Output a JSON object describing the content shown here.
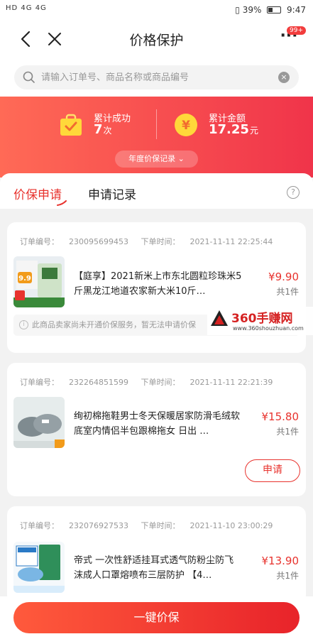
{
  "status_bar": {
    "left": "HD 4G 4G",
    "battery": "39%",
    "time": "9:47"
  },
  "nav": {
    "title": "价格保护",
    "badge": "99+"
  },
  "search": {
    "placeholder": "请输入订单号、商品名称或商品编号"
  },
  "summary": {
    "success_label": "累计成功",
    "success_value": "7",
    "success_unit": "次",
    "amount_label": "累计金额",
    "amount_value": "17.25",
    "amount_unit": "元",
    "record_link": "年度价保记录 ⌄"
  },
  "tabs": {
    "active": "价保申请",
    "inactive": "申请记录"
  },
  "orders": [
    {
      "order_label": "订单编号：",
      "order_no": "230095699453",
      "time_label": "下单时间：",
      "time": "2021-11-11 22:25:44",
      "name": "【庭享】2021新米上市东北圆粒珍珠米5斤黑龙江地道农家新大米10斤…",
      "price": "¥9.90",
      "qty": "共1件",
      "notice": "此商品卖家尚未开通价保服务，暂无法申请价保"
    },
    {
      "order_label": "订单编号：",
      "order_no": "232264851599",
      "time_label": "下单时间：",
      "time": "2021-11-11 22:21:39",
      "name": "绚初棉拖鞋男士冬天保暖居家防滑毛绒软底室内情侣半包跟棉拖女 日出 …",
      "price": "¥15.80",
      "qty": "共1件",
      "action": "申请"
    },
    {
      "order_label": "订单编号：",
      "order_no": "232076927533",
      "time_label": "下单时间：",
      "time": "2021-11-10 23:00:29",
      "name": "帝式 一次性舒适挂耳式透气防粉尘防飞沫成人口罩熔喷布三层防护 【4…",
      "price": "¥13.90",
      "qty": "共1件"
    }
  ],
  "watermark": {
    "title": "360手赚网",
    "url": "www.360shouzhuan.com"
  },
  "bottom": {
    "button": "一键价保"
  }
}
